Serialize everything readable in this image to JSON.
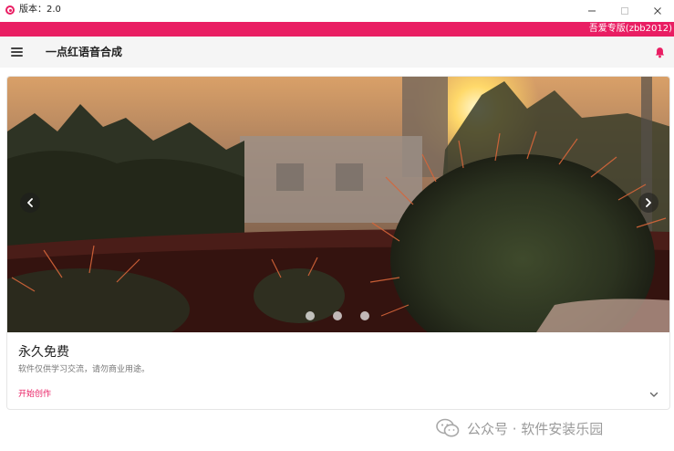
{
  "window": {
    "title": "版本：2.0",
    "edition_label": "吾爱专版(zbb2012)"
  },
  "appbar": {
    "title": "一点红语音合成"
  },
  "card": {
    "title": "永久免费",
    "subtitle": "软件仅供学习交流，请勿商业用途。",
    "action_label": "开始创作",
    "carousel": {
      "slide_count": 3,
      "active_slide": 1
    }
  },
  "watermark": {
    "text": "公众号 · 软件安装乐园"
  },
  "colors": {
    "accent": "#e91e63",
    "appbar_bg": "#f5f5f5"
  }
}
